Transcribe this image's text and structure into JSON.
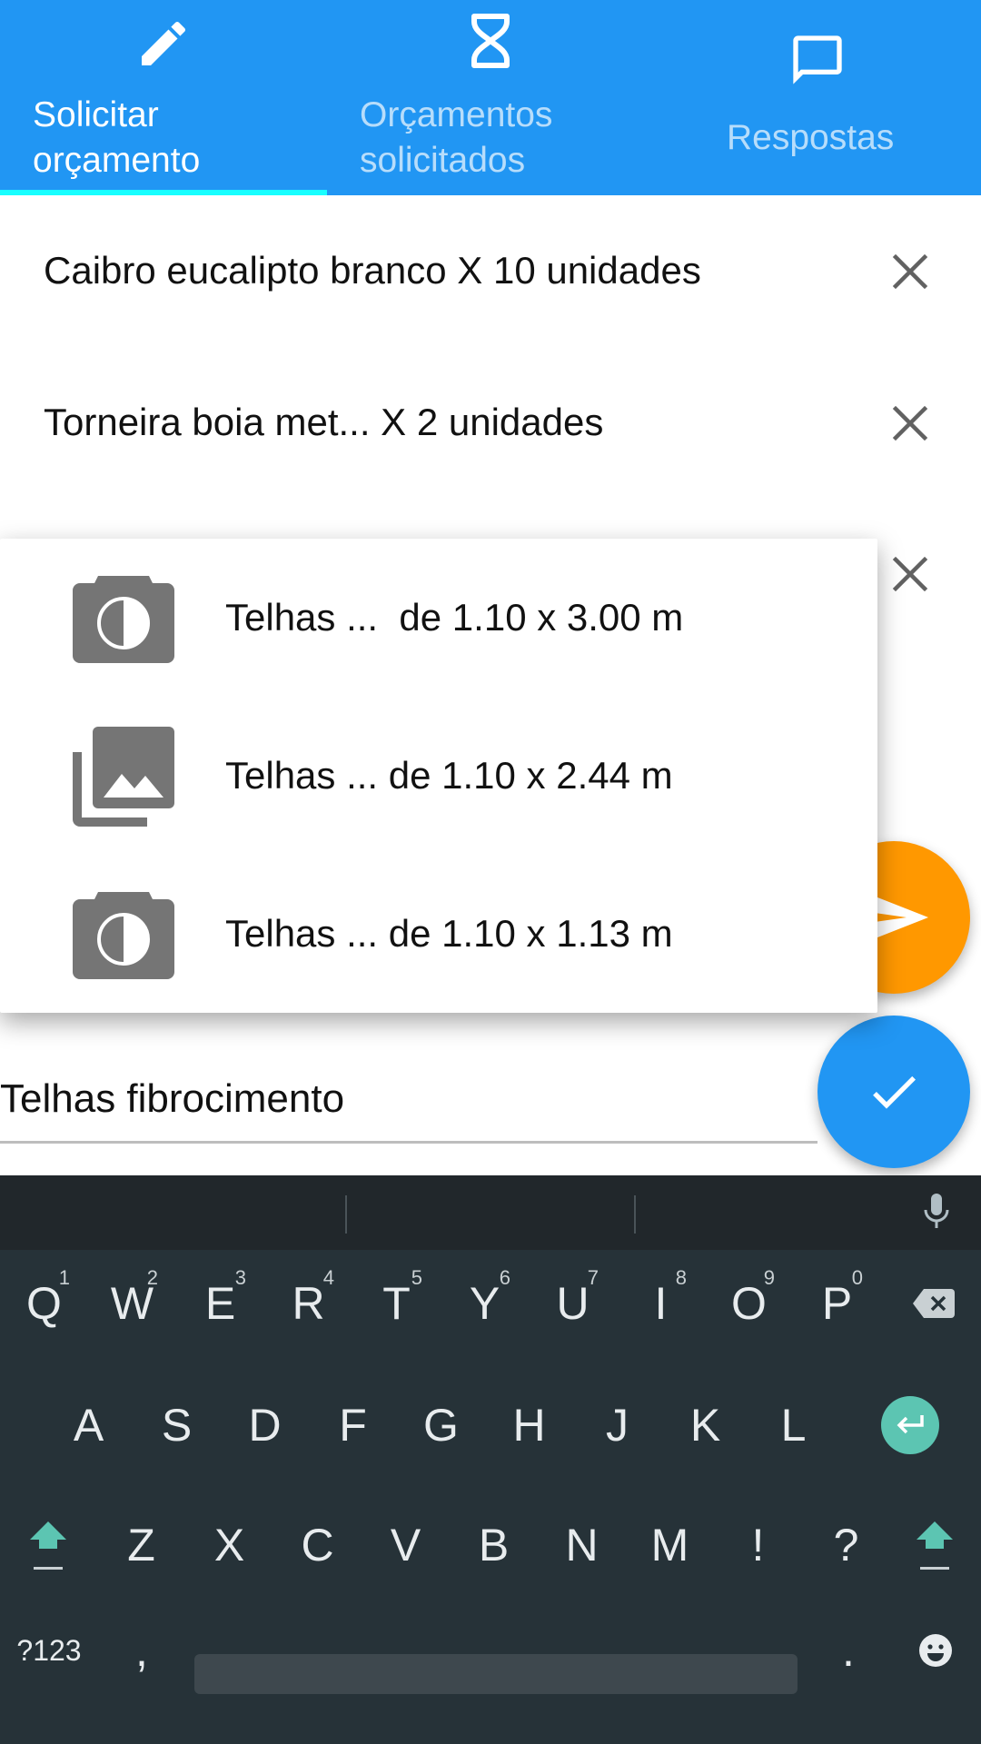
{
  "tabs": [
    {
      "label_line1": "Solicitar",
      "label_line2": "orçamento",
      "icon": "pencil-icon",
      "selected": true
    },
    {
      "label_line1": "Orçamentos",
      "label_line2": "solicitados",
      "icon": "hourglass-icon",
      "selected": false
    },
    {
      "label_line1": "Respostas",
      "label_line2": "",
      "icon": "chat-bubble-icon",
      "selected": false
    }
  ],
  "items": [
    {
      "text": "Caibro eucalipto branco X 10 unidades",
      "remove_icon": "close-icon"
    },
    {
      "text": "Torneira boia  met... X 2 unidades",
      "remove_icon": "close-icon"
    },
    {
      "text": "",
      "remove_icon": "close-icon"
    }
  ],
  "suggestions": [
    {
      "text": "Telhas ...  de 1.10 x 3.00 m",
      "icon": "camera-icon"
    },
    {
      "text": "Telhas ... de 1.10 x 2.44 m",
      "icon": "gallery-icon"
    },
    {
      "text": "Telhas ... de 1.10 x 1.13 m",
      "icon": "camera-icon"
    }
  ],
  "search": {
    "value": "Telhas fibrocimento"
  },
  "fab": {
    "send_icon": "send-icon",
    "confirm_icon": "check-icon"
  },
  "keyboard": {
    "row1": [
      {
        "key": "Q",
        "hint": "1"
      },
      {
        "key": "W",
        "hint": "2"
      },
      {
        "key": "E",
        "hint": "3"
      },
      {
        "key": "R",
        "hint": "4"
      },
      {
        "key": "T",
        "hint": "5"
      },
      {
        "key": "Y",
        "hint": "6"
      },
      {
        "key": "U",
        "hint": "7"
      },
      {
        "key": "I",
        "hint": "8"
      },
      {
        "key": "O",
        "hint": "9"
      },
      {
        "key": "P",
        "hint": "0"
      }
    ],
    "row2": [
      "A",
      "S",
      "D",
      "F",
      "G",
      "H",
      "J",
      "K",
      "L"
    ],
    "row3": [
      "Z",
      "X",
      "C",
      "V",
      "B",
      "N",
      "M",
      "!",
      "?"
    ],
    "symbols_key": "?123",
    "comma_key": ",",
    "period_key": ".",
    "backspace_icon": "backspace-icon",
    "enter_icon": "enter-icon",
    "shift_icon": "shift-icon",
    "mic_icon": "mic-icon",
    "emoji_icon": "emoji-icon"
  },
  "colors": {
    "primary": "#2196F3",
    "tab_indicator": "#18FFFF",
    "accent": "#FF9800",
    "keyboard_bg": "#263238",
    "enter_key": "#5CC5B2"
  }
}
